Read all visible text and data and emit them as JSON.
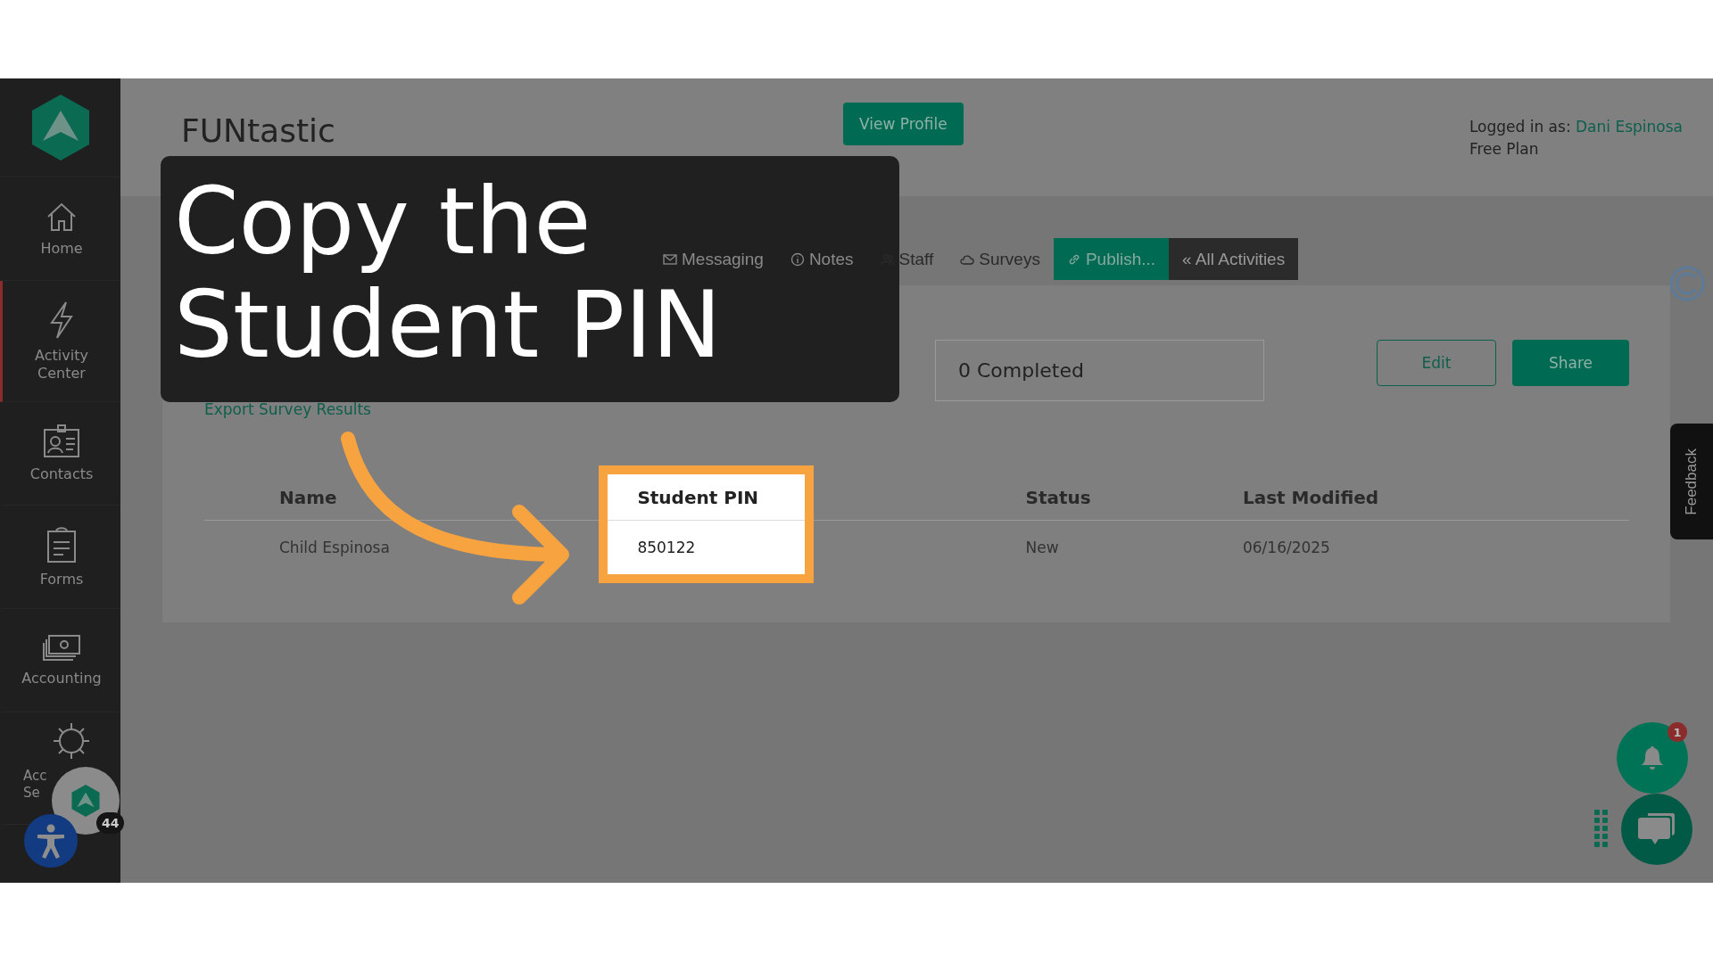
{
  "sidebar": {
    "items": [
      {
        "kind": "home",
        "lines": [
          "Home"
        ],
        "selected": false
      },
      {
        "kind": "bolt",
        "lines": [
          "Activity",
          "Center"
        ],
        "selected": true
      },
      {
        "kind": "contact",
        "lines": [
          "Contacts"
        ],
        "selected": false
      },
      {
        "kind": "clipboard",
        "lines": [
          "Forms"
        ],
        "selected": false
      },
      {
        "kind": "money",
        "lines": [
          "Accounting"
        ],
        "selected": false
      },
      {
        "kind": "gear",
        "lines": [
          "Acc",
          "Se"
        ],
        "selected": false
      }
    ]
  },
  "header": {
    "title": "FUNtastic",
    "view_profile": "View Profile",
    "login_label": "Logged in as:",
    "user_name": "Dani Espinosa",
    "plan": "Free Plan"
  },
  "tabs": [
    {
      "kind": "tab",
      "label": "Messaging",
      "selected": false
    },
    {
      "kind": "tab",
      "label": "Notes",
      "selected": false
    },
    {
      "kind": "tab",
      "label": "Staff",
      "selected": false
    },
    {
      "kind": "tab",
      "label": "Surveys",
      "selected": false
    },
    {
      "kind": "tab",
      "label": "Publish...",
      "selected": true
    },
    {
      "kind": "back",
      "label": "« All Activities",
      "selected": false
    }
  ],
  "stat": "0 Completed",
  "buttons": {
    "edit": "Edit",
    "share": "Share"
  },
  "export_link": "Export Survey Results",
  "table": {
    "columns": [
      {
        "label": "Name",
        "highlighted": false
      },
      {
        "label": "Student PIN",
        "highlighted": true
      },
      {
        "label": "Status",
        "highlighted": false
      },
      {
        "label": "Last Modified",
        "highlighted": false
      }
    ],
    "rows": [
      [
        "Child Espinosa",
        "850122",
        "New",
        "06/16/2025"
      ]
    ]
  },
  "callout": {
    "lines": [
      "Copy the",
      "Student PIN"
    ]
  },
  "feedback": "Feedback",
  "notification_count": "1",
  "avatar_badge": "44"
}
